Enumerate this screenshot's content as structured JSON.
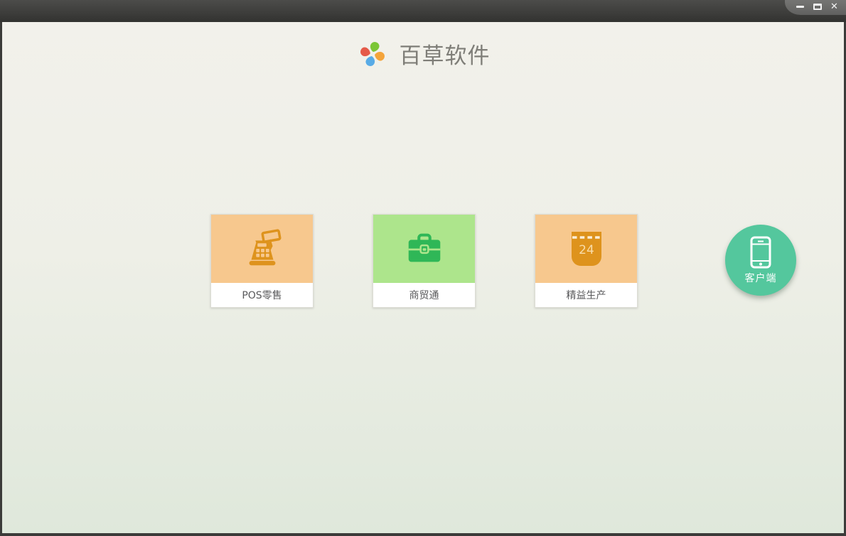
{
  "window": {
    "controls": {
      "minimize": "minimize",
      "maximize": "maximize",
      "close_glyph": "✕"
    }
  },
  "header": {
    "title": "百草软件",
    "logo_icon": "pinwheel-logo-icon",
    "logo_colors": {
      "top": "#7CC636",
      "right": "#F4A43B",
      "bottom": "#58ABE6",
      "left": "#E55A49"
    }
  },
  "products": [
    {
      "id": "pos",
      "label": "POS零售",
      "icon": "cash-register-icon",
      "tile_color": "#F7C88E",
      "icon_color": "#DE931D"
    },
    {
      "id": "trade",
      "label": "商贸通",
      "icon": "briefcase-icon",
      "tile_color": "#ADE58C",
      "icon_color": "#2FB757"
    },
    {
      "id": "lean",
      "label": "精益生产",
      "icon": "calendar-icon",
      "calendar_day": "24",
      "tile_color": "#F7C88E",
      "icon_color": "#DE931D"
    }
  ],
  "client_button": {
    "label": "客户端",
    "icon": "smartphone-icon",
    "color": "#54C79D"
  },
  "theme": {
    "titlebar": "#3E3E3C",
    "window_border": "#3B3B39",
    "bg_top": "#F2F1EB",
    "bg_bottom": "#DFE8DB",
    "card_label_text": "#59595B",
    "logo_title_text": "#7F7E78"
  }
}
